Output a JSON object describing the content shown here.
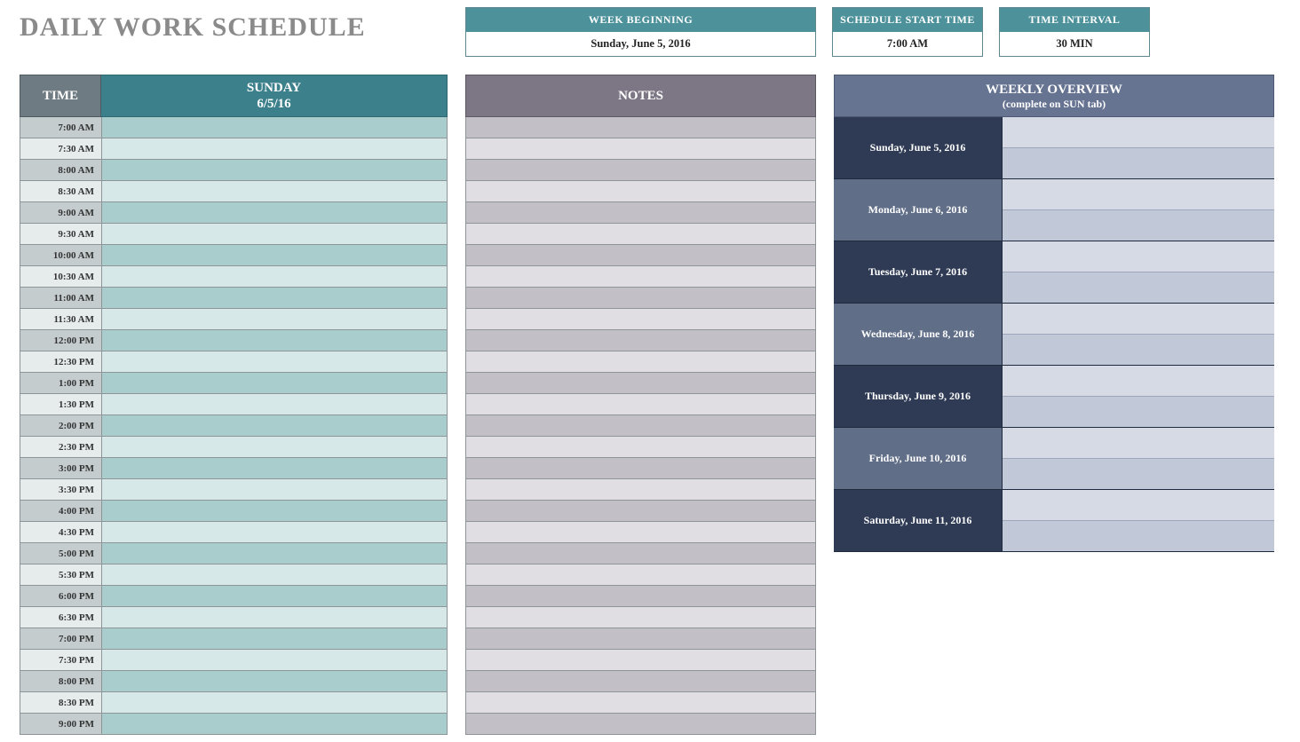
{
  "title": "DAILY WORK SCHEDULE",
  "info": {
    "week_beginning": {
      "label": "WEEK BEGINNING",
      "value": "Sunday, June 5, 2016"
    },
    "start_time": {
      "label": "SCHEDULE START TIME",
      "value": "7:00 AM"
    },
    "interval": {
      "label": "TIME INTERVAL",
      "value": "30 MIN"
    }
  },
  "schedule": {
    "time_header": "TIME",
    "day_name": "SUNDAY",
    "day_date": "6/5/16",
    "times": [
      "7:00 AM",
      "7:30 AM",
      "8:00 AM",
      "8:30 AM",
      "9:00 AM",
      "9:30 AM",
      "10:00 AM",
      "10:30 AM",
      "11:00 AM",
      "11:30 AM",
      "12:00 PM",
      "12:30 PM",
      "1:00 PM",
      "1:30 PM",
      "2:00 PM",
      "2:30 PM",
      "3:00 PM",
      "3:30 PM",
      "4:00 PM",
      "4:30 PM",
      "5:00 PM",
      "5:30 PM",
      "6:00 PM",
      "6:30 PM",
      "7:00 PM",
      "7:30 PM",
      "8:00 PM",
      "8:30 PM",
      "9:00 PM"
    ]
  },
  "notes": {
    "header": "NOTES",
    "row_count": 29
  },
  "overview": {
    "header": "WEEKLY OVERVIEW",
    "sub": "(complete on SUN tab)",
    "days": [
      "Sunday, June 5, 2016",
      "Monday, June 6, 2016",
      "Tuesday, June 7, 2016",
      "Wednesday, June 8, 2016",
      "Thursday, June 9, 2016",
      "Friday, June 10, 2016",
      "Saturday, June 11, 2016"
    ]
  }
}
